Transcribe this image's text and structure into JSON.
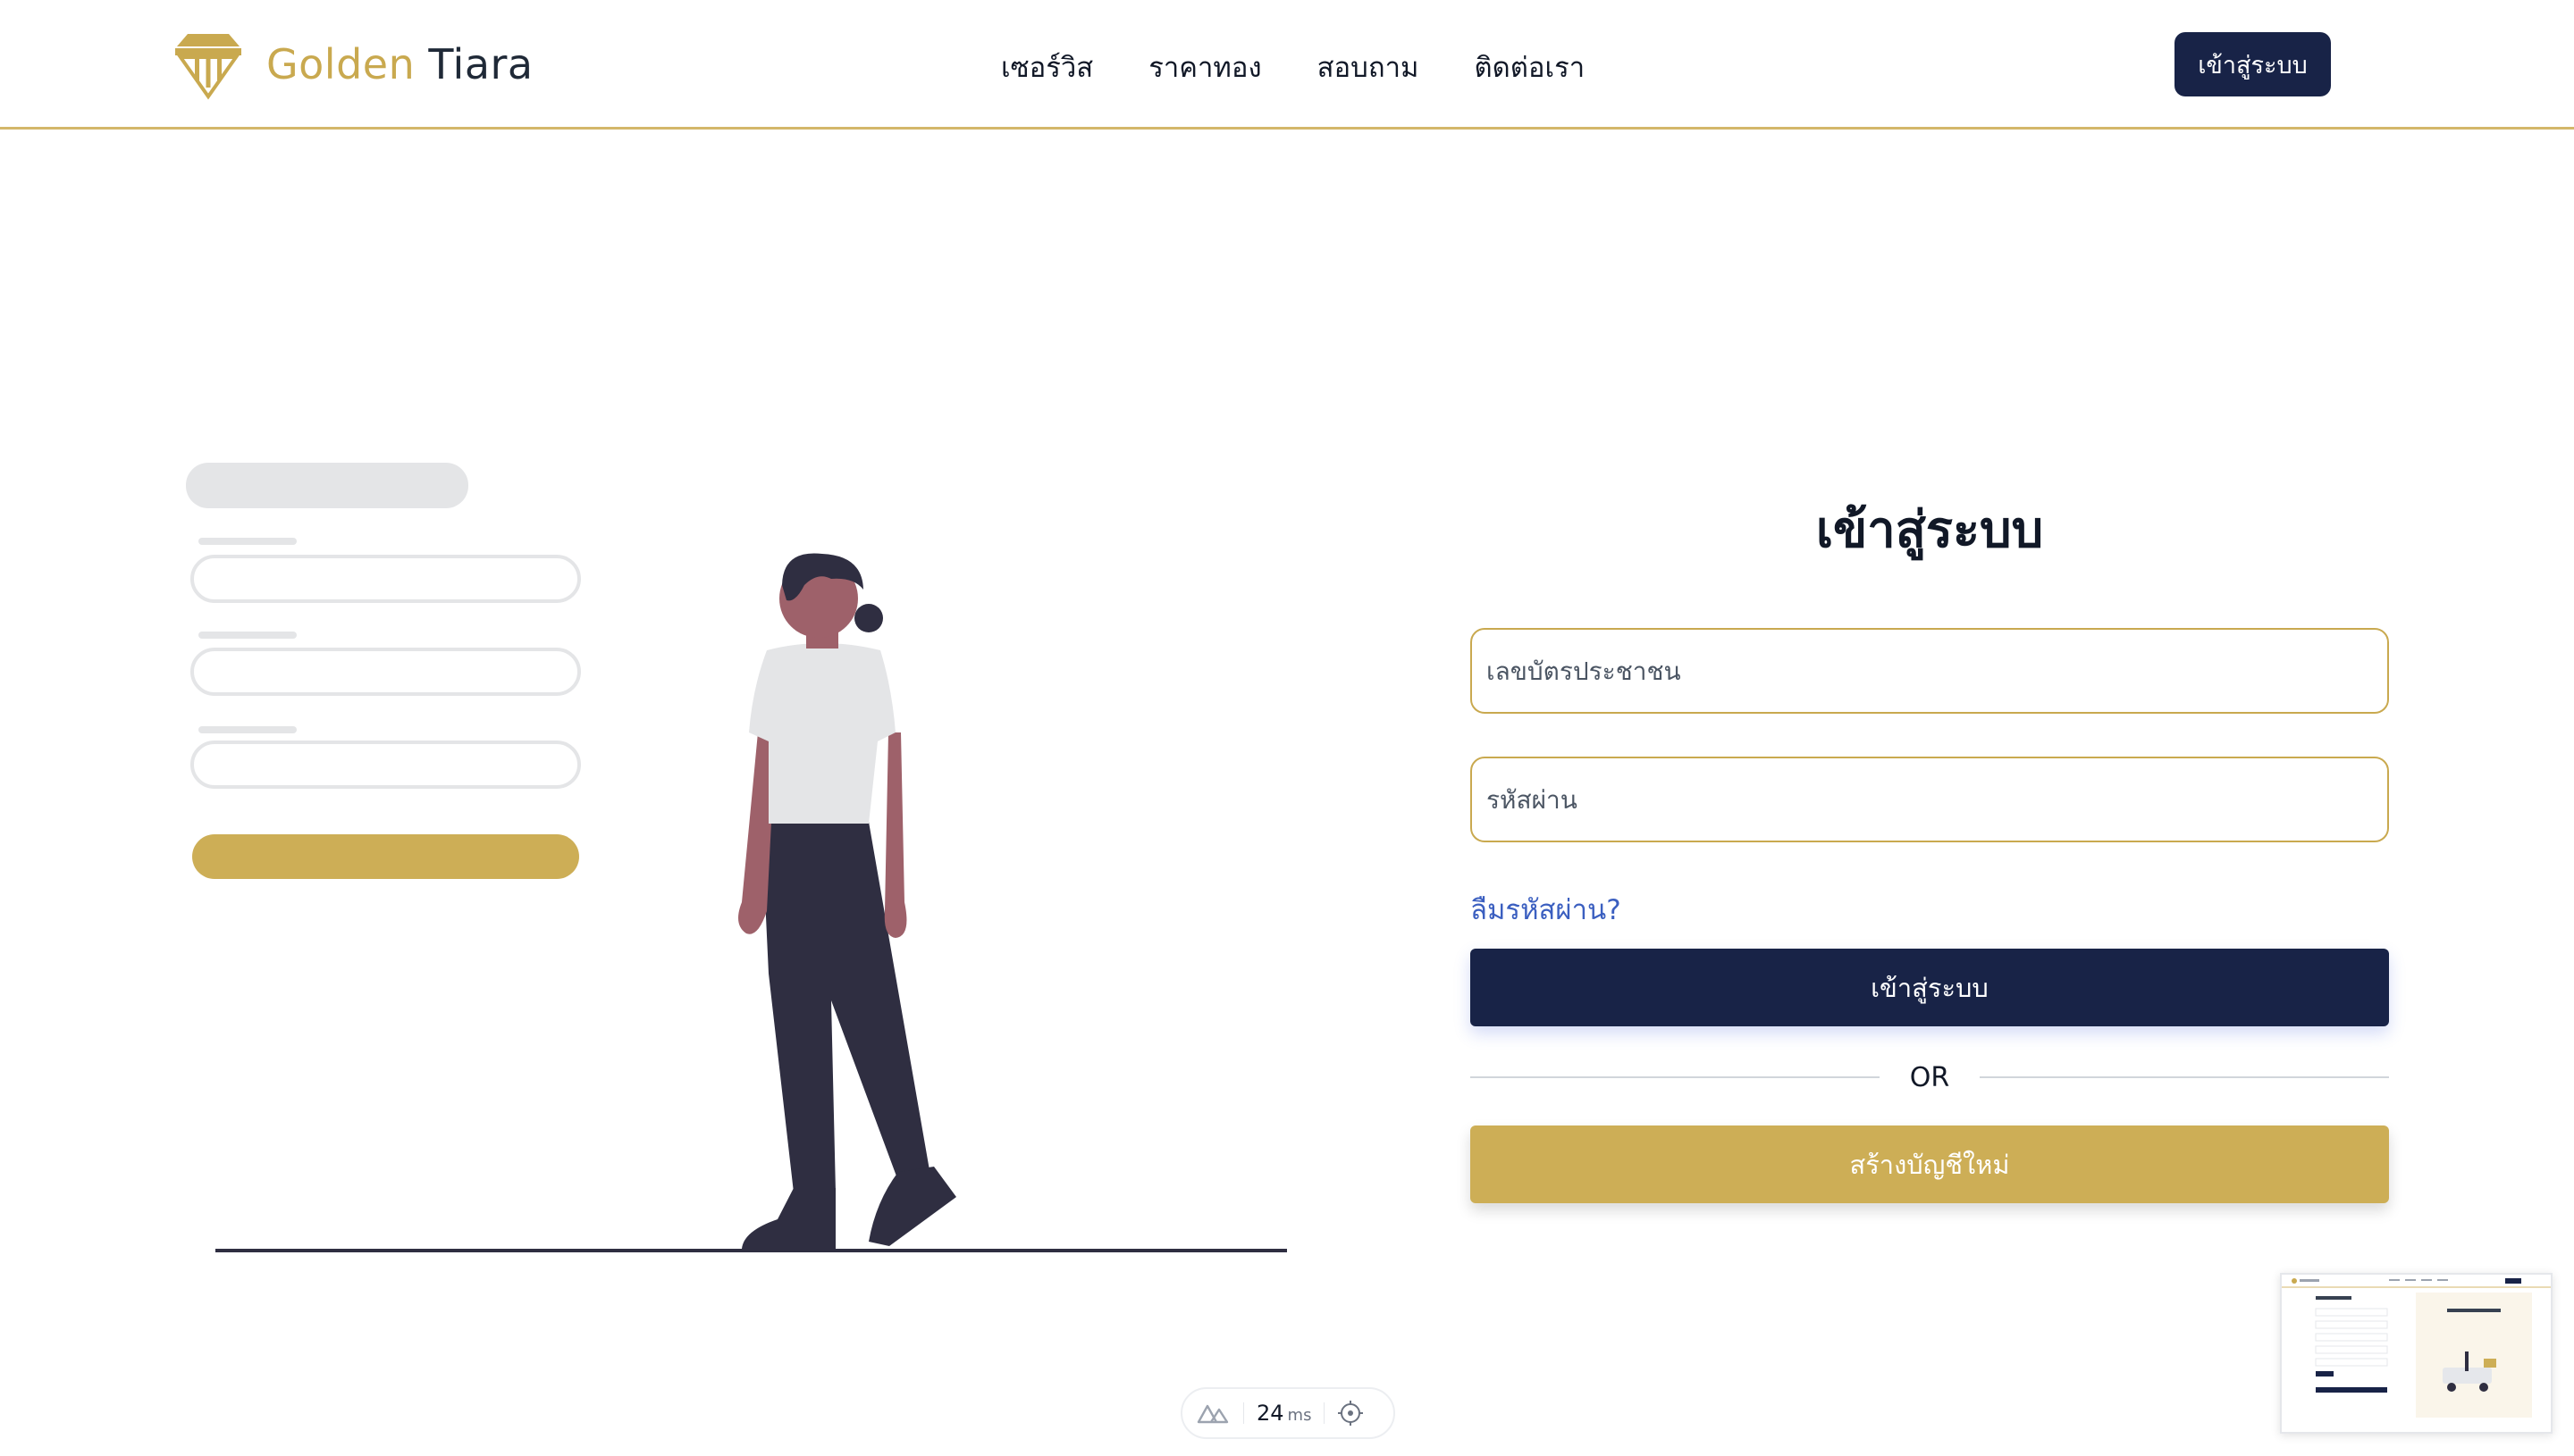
{
  "header": {
    "brand_first": "Golden",
    "brand_second": "Tiara",
    "nav": [
      "เซอร์วิส",
      "ราคาทอง",
      "สอบถาม",
      "ติดต่อเรา"
    ],
    "login_button": "เข้าสู่ระบบ"
  },
  "form": {
    "title": "เข้าสู่ระบบ",
    "id_placeholder": "เลขบัตรประชาชน",
    "password_placeholder": "รหัสผ่าน",
    "forgot_link": "ลืมรหัสผ่าน?",
    "login_button": "เข้าสู่ระบบ",
    "or_text": "OR",
    "register_button": "สร้างบัญชีใหม่"
  },
  "devtools": {
    "render_time": "24",
    "unit": "ms"
  },
  "colors": {
    "navy": "#182347",
    "gold": "#cdae56",
    "link": "#3b5fc0"
  }
}
